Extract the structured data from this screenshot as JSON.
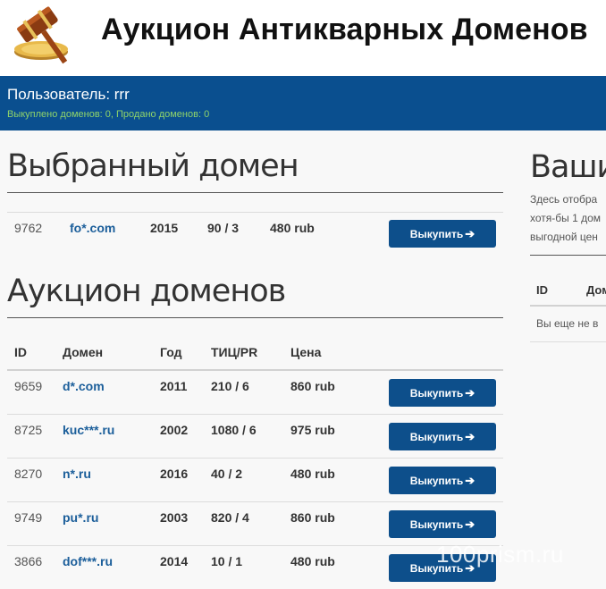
{
  "header": {
    "title": "Аукцион Антикварных Доменов",
    "logo_icon": "gavel-coin-icon"
  },
  "user": {
    "name_line": "Пользователь: rrr",
    "stats_line": "Выкуплено доменов: 0, Продано доменов: 0"
  },
  "selected": {
    "heading": "Выбранный домен",
    "row": {
      "id": "9762",
      "domain": "fo*.com",
      "year": "2015",
      "tic": "90 / 3",
      "price": "480 rub",
      "button": "Выкупить"
    }
  },
  "auction": {
    "heading": "Аукцион доменов",
    "columns": [
      "ID",
      "Домен",
      "Год",
      "ТИЦ/PR",
      "Цена"
    ],
    "rows": [
      {
        "id": "9659",
        "domain": "d*.com",
        "year": "2011",
        "tic": "210 / 6",
        "price": "860 rub",
        "button": "Выкупить"
      },
      {
        "id": "8725",
        "domain": "kuc***.ru",
        "year": "2002",
        "tic": "1080 / 6",
        "price": "975 rub",
        "button": "Выкупить"
      },
      {
        "id": "8270",
        "domain": "n*.ru",
        "year": "2016",
        "tic": "40 / 2",
        "price": "480 rub",
        "button": "Выкупить"
      },
      {
        "id": "9749",
        "domain": "pu*.ru",
        "year": "2003",
        "tic": "820 / 4",
        "price": "860 rub",
        "button": "Выкупить"
      },
      {
        "id": "3866",
        "domain": "dof***.ru",
        "year": "2014",
        "tic": "10 / 1",
        "price": "480 rub",
        "button": "Выкупить"
      }
    ]
  },
  "side": {
    "heading": "Ваши",
    "lines": [
      "Здесь отобра",
      "хотя-бы 1 дом",
      "выгодной цен"
    ],
    "columns": [
      "ID",
      "Дом"
    ],
    "empty": "Вы еще не в"
  },
  "watermark": "100prism.ru",
  "colors": {
    "accent": "#0a4f8f",
    "button": "#0d4f8b",
    "link": "#1b5e9a",
    "stats": "#8fd36a"
  }
}
